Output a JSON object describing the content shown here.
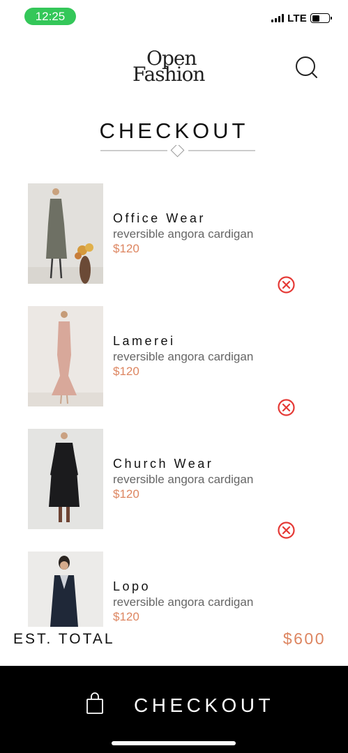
{
  "status_bar": {
    "time": "12:25",
    "network": "LTE",
    "battery_level": 0.45,
    "time_pill_color": "#34c759"
  },
  "header": {
    "logo_line1": "Open",
    "logo_line2": "Fashion",
    "search_icon": "search-icon"
  },
  "page_title": "CHECKOUT",
  "items": [
    {
      "name": "Office Wear",
      "description": "reversible angora cardigan",
      "price": "$120",
      "thumb_colors": [
        "#e2e0dc",
        "#6e7064"
      ]
    },
    {
      "name": "Lamerei",
      "description": "reversible angora cardigan",
      "price": "$120",
      "thumb_colors": [
        "#ece8e4",
        "#d8a89a"
      ]
    },
    {
      "name": "Church Wear",
      "description": "reversible angora cardigan",
      "price": "$120",
      "thumb_colors": [
        "#e4e4e2",
        "#1b1b1d"
      ]
    },
    {
      "name": "Lopo",
      "description": "reversible angora cardigan",
      "price": "$120",
      "thumb_colors": [
        "#ecebe9",
        "#1f2838"
      ]
    }
  ],
  "total": {
    "label": "EST. TOTAL",
    "value": "$600"
  },
  "checkout_button": {
    "label": "CHECKOUT",
    "icon": "shopping-bag-icon"
  },
  "colors": {
    "accent": "#dd8560",
    "remove": "#e53935",
    "bar": "#000000"
  }
}
